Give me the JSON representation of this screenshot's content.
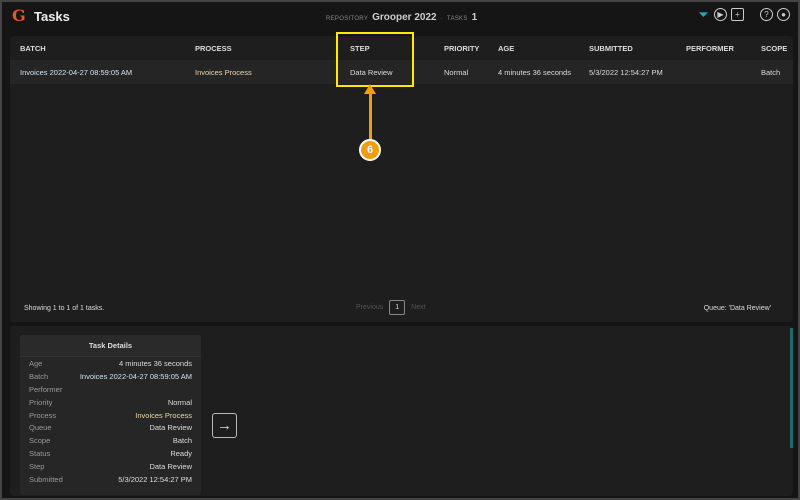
{
  "app": {
    "logo": "G",
    "title": "Tasks",
    "repository_label": "REPOSITORY",
    "repository": "Grooper 2022",
    "tasks_label": "TASKS",
    "tasks_count": "1"
  },
  "toolbar": {
    "icons": [
      "filter-icon",
      "play-icon",
      "folder-add-icon",
      "help-icon",
      "user-icon"
    ]
  },
  "table": {
    "headers": [
      "BATCH",
      "PROCESS",
      "STEP",
      "PRIORITY",
      "AGE",
      "SUBMITTED",
      "PERFORMER",
      "SCOPE"
    ],
    "rows": [
      {
        "batch": "Invoices 2022-04-27 08:59:05 AM",
        "process": "Invoices Process",
        "step": "Data Review",
        "priority": "Normal",
        "age": "4 minutes 36 seconds",
        "submitted": "5/3/2022 12:54:27 PM",
        "performer": "",
        "scope": "Batch"
      }
    ]
  },
  "footer": {
    "showing": "Showing 1 to 1 of 1 tasks.",
    "previous": "Previous",
    "page": "1",
    "next": "Next",
    "queue": "Queue: 'Data Review'"
  },
  "annotation": {
    "number": "6",
    "highlight_color": "#ffeb00",
    "callout_color": "#f39c12"
  },
  "details": {
    "title": "Task Details",
    "rows": [
      {
        "k": "Age",
        "v": "4 minutes 36 seconds"
      },
      {
        "k": "Batch",
        "v": "Invoices 2022-04-27 08:59:05 AM"
      },
      {
        "k": "Performer",
        "v": ""
      },
      {
        "k": "Priority",
        "v": "Normal"
      },
      {
        "k": "Process",
        "v": "Invoices Process"
      },
      {
        "k": "Queue",
        "v": "Data Review"
      },
      {
        "k": "Scope",
        "v": "Batch"
      },
      {
        "k": "Status",
        "v": "Ready"
      },
      {
        "k": "Step",
        "v": "Data Review"
      },
      {
        "k": "Submitted",
        "v": "5/3/2022 12:54:27 PM"
      }
    ]
  }
}
